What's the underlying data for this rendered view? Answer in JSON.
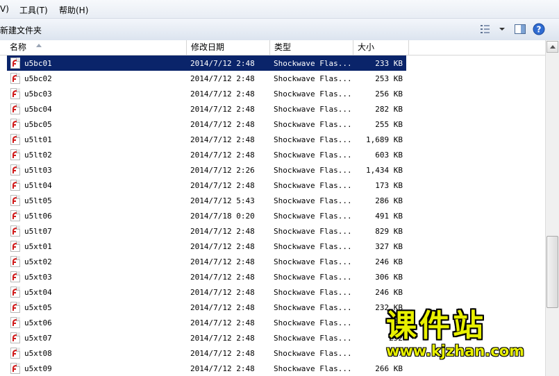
{
  "menubar": {
    "items": [
      "V)",
      "工具(T)",
      "帮助(H)"
    ]
  },
  "toolbar": {
    "new_folder_label": "新建文件夹",
    "icons": [
      "view-options-icon",
      "dropdown-chevron-icon",
      "preview-pane-icon",
      "help-icon"
    ]
  },
  "columns": {
    "name": "名称",
    "date": "修改日期",
    "type": "类型",
    "size": "大小"
  },
  "files": [
    {
      "name": "u5bc01",
      "date": "2014/7/12 2:48",
      "type": "Shockwave Flas...",
      "size": "233 KB",
      "selected": true
    },
    {
      "name": "u5bc02",
      "date": "2014/7/12 2:48",
      "type": "Shockwave Flas...",
      "size": "253 KB"
    },
    {
      "name": "u5bc03",
      "date": "2014/7/12 2:48",
      "type": "Shockwave Flas...",
      "size": "256 KB"
    },
    {
      "name": "u5bc04",
      "date": "2014/7/12 2:48",
      "type": "Shockwave Flas...",
      "size": "282 KB"
    },
    {
      "name": "u5bc05",
      "date": "2014/7/12 2:48",
      "type": "Shockwave Flas...",
      "size": "255 KB"
    },
    {
      "name": "u5lt01",
      "date": "2014/7/12 2:48",
      "type": "Shockwave Flas...",
      "size": "1,689 KB"
    },
    {
      "name": "u5lt02",
      "date": "2014/7/12 2:48",
      "type": "Shockwave Flas...",
      "size": "603 KB"
    },
    {
      "name": "u5lt03",
      "date": "2014/7/12 2:26",
      "type": "Shockwave Flas...",
      "size": "1,434 KB"
    },
    {
      "name": "u5lt04",
      "date": "2014/7/12 2:48",
      "type": "Shockwave Flas...",
      "size": "173 KB"
    },
    {
      "name": "u5lt05",
      "date": "2014/7/12 5:43",
      "type": "Shockwave Flas...",
      "size": "286 KB"
    },
    {
      "name": "u5lt06",
      "date": "2014/7/18 0:20",
      "type": "Shockwave Flas...",
      "size": "491 KB"
    },
    {
      "name": "u5lt07",
      "date": "2014/7/12 2:48",
      "type": "Shockwave Flas...",
      "size": "829 KB"
    },
    {
      "name": "u5xt01",
      "date": "2014/7/12 2:48",
      "type": "Shockwave Flas...",
      "size": "327 KB"
    },
    {
      "name": "u5xt02",
      "date": "2014/7/12 2:48",
      "type": "Shockwave Flas...",
      "size": "246 KB"
    },
    {
      "name": "u5xt03",
      "date": "2014/7/12 2:48",
      "type": "Shockwave Flas...",
      "size": "306 KB"
    },
    {
      "name": "u5xt04",
      "date": "2014/7/12 2:48",
      "type": "Shockwave Flas...",
      "size": "246 KB"
    },
    {
      "name": "u5xt05",
      "date": "2014/7/12 2:48",
      "type": "Shockwave Flas...",
      "size": "232 KB"
    },
    {
      "name": "u5xt06",
      "date": "2014/7/12 2:48",
      "type": "Shockwave Flas...",
      "size": "37"
    },
    {
      "name": "u5xt07",
      "date": "2014/7/12 2:48",
      "type": "Shockwave Flas...",
      "size": "252"
    },
    {
      "name": "u5xt08",
      "date": "2014/7/12 2:48",
      "type": "Shockwave Flas...",
      "size": "247"
    },
    {
      "name": "u5xt09",
      "date": "2014/7/12 2:48",
      "type": "Shockwave Flas...",
      "size": "266 KB"
    }
  ],
  "watermark": {
    "title": "课件站",
    "url": "www.kjzhan.com"
  },
  "colors": {
    "selection": "#0a246a",
    "watermark": "#e8f000",
    "file_icon_red": "#d11a1a"
  }
}
